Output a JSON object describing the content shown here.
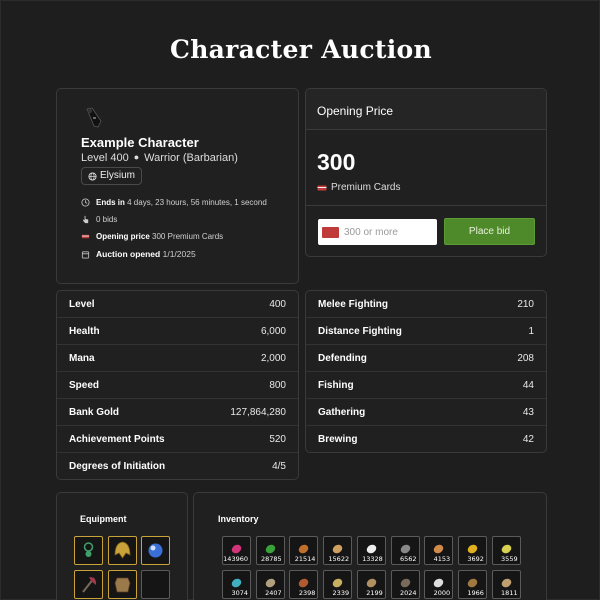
{
  "page": {
    "title": "Character Auction"
  },
  "character": {
    "name": "Example Character",
    "level_text": "Level 400",
    "vocation": "Warrior (Barbarian)",
    "world": "Elysium",
    "ends_label": "Ends in",
    "ends_value": "4 days, 23 hours, 56 minutes, 1 second",
    "bids": "0 bids",
    "opening_label": "Opening price",
    "opening_value": "300 Premium Cards",
    "opened_label": "Auction opened",
    "opened_value": "1/1/2025"
  },
  "price": {
    "header": "Opening Price",
    "value": "300",
    "unit": "Premium Cards",
    "input_placeholder": "300 or more",
    "button": "Place bid"
  },
  "stats_left": [
    {
      "label": "Level",
      "value": "400"
    },
    {
      "label": "Health",
      "value": "6,000"
    },
    {
      "label": "Mana",
      "value": "2,000"
    },
    {
      "label": "Speed",
      "value": "800"
    },
    {
      "label": "Bank Gold",
      "value": "127,864,280"
    },
    {
      "label": "Achievement Points",
      "value": "520"
    },
    {
      "label": "Degrees of Initiation",
      "value": "4/5"
    }
  ],
  "stats_right": [
    {
      "label": "Melee Fighting",
      "value": "210"
    },
    {
      "label": "Distance Fighting",
      "value": "1"
    },
    {
      "label": "Defending",
      "value": "208"
    },
    {
      "label": "Fishing",
      "value": "44"
    },
    {
      "label": "Gathering",
      "value": "43"
    },
    {
      "label": "Brewing",
      "value": "42"
    }
  ],
  "equipment": {
    "title": "Equipment",
    "slots": [
      {
        "icon": "amulet-icon",
        "color": "#3fa06a"
      },
      {
        "icon": "helmet-icon",
        "color": "#c9a33a"
      },
      {
        "icon": "orb-icon",
        "color": "#3a6fd8"
      },
      {
        "icon": "axe-icon",
        "color": "#a03a4a"
      },
      {
        "icon": "armor-icon",
        "color": "#9a7a4a"
      },
      {
        "icon": "empty-slot",
        "color": "#000000"
      }
    ]
  },
  "inventory": {
    "title": "Inventory",
    "items": [
      {
        "icon": "potion-icon",
        "count": "143960",
        "color": "#d0357a"
      },
      {
        "icon": "clover-icon",
        "count": "28785",
        "color": "#3aa03a"
      },
      {
        "icon": "arrow-icon",
        "count": "21514",
        "color": "#c0702a"
      },
      {
        "icon": "bolt-icon",
        "count": "15622",
        "color": "#d0a060"
      },
      {
        "icon": "hand-icon",
        "count": "13328",
        "color": "#eeeeee"
      },
      {
        "icon": "stone-icon",
        "count": "6562",
        "color": "#888888"
      },
      {
        "icon": "arrow-icon",
        "count": "4153",
        "color": "#d08a4a"
      },
      {
        "icon": "card-icon",
        "count": "3692",
        "color": "#e0b020"
      },
      {
        "icon": "scroll-icon",
        "count": "3559",
        "color": "#d8d050"
      },
      {
        "icon": "crystal-icon",
        "count": "3074",
        "color": "#40b0c0"
      },
      {
        "icon": "skull-icon",
        "count": "2407",
        "color": "#b0a080"
      },
      {
        "icon": "spider-icon",
        "count": "2398",
        "color": "#b05a30"
      },
      {
        "icon": "bone-icon",
        "count": "2339",
        "color": "#c8b060"
      },
      {
        "icon": "sword-icon",
        "count": "2199",
        "color": "#b09060"
      },
      {
        "icon": "rock-icon",
        "count": "2024",
        "color": "#7a6a5a"
      },
      {
        "icon": "dot-icon",
        "count": "2000",
        "color": "#dddddd"
      },
      {
        "icon": "staff-icon",
        "count": "1966",
        "color": "#a07840"
      },
      {
        "icon": "leg-icon",
        "count": "1811",
        "color": "#c0a070"
      }
    ]
  }
}
